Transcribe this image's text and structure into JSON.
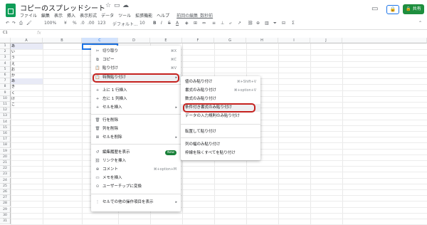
{
  "header": {
    "title": "コピーのスプレッドシート",
    "menus": [
      "ファイル",
      "編集",
      "表示",
      "挿入",
      "表示形式",
      "データ",
      "ツール",
      "拡張機能",
      "ヘルプ"
    ],
    "last_edit": "前回の編集_数秒前",
    "share_label": "共有"
  },
  "toolbar": {
    "zoom": "100%",
    "currency": "¥",
    "percent": "%",
    "decimal1": ".0",
    "decimal2": ".00",
    "number_format": "123",
    "font": "デフォルト...",
    "font_size": "10",
    "bold": "B",
    "italic": "I",
    "strike": "S",
    "text_color": "A"
  },
  "formula_bar": {
    "name_box": "C1",
    "fx": "fx"
  },
  "grid": {
    "columns": [
      "A",
      "B",
      "C",
      "D",
      "E",
      "F",
      "G",
      "H",
      "I",
      "J"
    ],
    "rows": [
      "1",
      "2",
      "3",
      "4",
      "5",
      "6",
      "7",
      "8",
      "9",
      "10",
      "11",
      "12",
      "13",
      "14",
      "15",
      "16",
      "17",
      "18",
      "19",
      "20",
      "21",
      "22",
      "23",
      "24",
      "25",
      "26",
      "27",
      "28",
      "29",
      "30",
      "31"
    ],
    "col_a_values": [
      "あ",
      "い",
      "う",
      "え",
      "お",
      "か",
      "あ",
      "き",
      "く",
      "け",
      "こ"
    ]
  },
  "context_menu": {
    "items": [
      {
        "icon": "✂",
        "label": "切り取り",
        "shortcut": "⌘X"
      },
      {
        "icon": "⧉",
        "label": "コピー",
        "shortcut": "⌘C"
      },
      {
        "icon": "📋",
        "label": "貼り付け",
        "shortcut": "⌘V"
      },
      {
        "icon": "📋",
        "label": "特殊貼り付け",
        "arrow": "▸"
      },
      {
        "icon": "+",
        "label": "上に 1 行挿入"
      },
      {
        "icon": "+",
        "label": "左に 1 列挿入"
      },
      {
        "icon": "+",
        "label": "セルを挿入",
        "arrow": "▸"
      },
      {
        "icon": "🗑",
        "label": "行を削除"
      },
      {
        "icon": "🗑",
        "label": "列を削除"
      },
      {
        "icon": "⊠",
        "label": "セルを削除",
        "arrow": "▸"
      },
      {
        "icon": "↺",
        "label": "編集履歴を表示",
        "badge": "New"
      },
      {
        "icon": "⛓",
        "label": "リンクを挿入"
      },
      {
        "icon": "⊕",
        "label": "コメント",
        "shortcut": "⌘+option+M"
      },
      {
        "icon": "▭",
        "label": "メモを挿入"
      },
      {
        "icon": "⊙",
        "label": "ユーザーチップに変換"
      },
      {
        "icon": "⋮",
        "label": "セルでの他の操作項目を表示",
        "arrow": "▸"
      }
    ]
  },
  "submenu": {
    "items": [
      {
        "label": "値のみ貼り付け",
        "shortcut": "⌘+Shift+V"
      },
      {
        "label": "書式のみ貼り付け",
        "shortcut": "⌘+option+V"
      },
      {
        "label": "数式のみ貼り付け"
      },
      {
        "label": "条件付き書式のみ貼り付け"
      },
      {
        "label": "データの入力規則のみ貼り付け"
      },
      {
        "label": "転置して貼り付け"
      },
      {
        "label": "列の幅のみ貼り付け"
      },
      {
        "label": "枠線を除くすべてを貼り付け"
      }
    ]
  },
  "colors": {
    "highlight_outline": "#c5221f",
    "share_green": "#1e8e3e",
    "accent_blue": "#1a73e8",
    "selected_row_fill": "#e8eaf6"
  }
}
